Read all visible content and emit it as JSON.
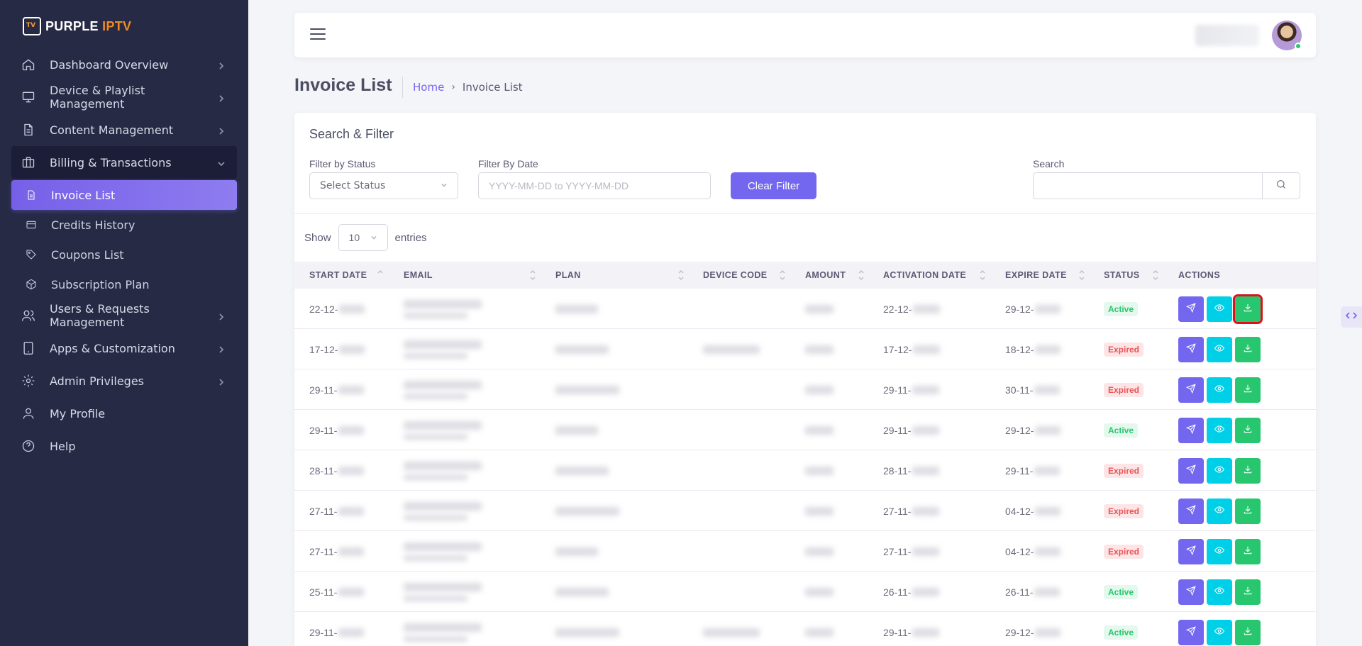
{
  "brand": {
    "part1": "PURPLE",
    "part2": "IPTV"
  },
  "sidebar": {
    "items": [
      {
        "label": "Dashboard Overview",
        "icon": "home-icon"
      },
      {
        "label": "Device & Playlist Management",
        "icon": "monitor-icon"
      },
      {
        "label": "Content Management",
        "icon": "file-icon"
      },
      {
        "label": "Billing & Transactions",
        "icon": "briefcase-icon"
      },
      {
        "label": "Users & Requests Management",
        "icon": "users-icon"
      },
      {
        "label": "Apps & Customization",
        "icon": "tablet-icon"
      },
      {
        "label": "Admin Privileges",
        "icon": "gear-icon"
      },
      {
        "label": "My Profile",
        "icon": "user-icon"
      },
      {
        "label": "Help",
        "icon": "help-icon"
      }
    ],
    "billing_sub": [
      {
        "label": "Invoice List",
        "icon": "document-icon"
      },
      {
        "label": "Credits History",
        "icon": "credit-card-icon"
      },
      {
        "label": "Coupons List",
        "icon": "tag-icon"
      },
      {
        "label": "Subscription Plan",
        "icon": "box-icon"
      }
    ]
  },
  "header": {
    "title": "Invoice List",
    "breadcrumb_home": "Home",
    "breadcrumb_sep": "›",
    "breadcrumb_current": "Invoice List"
  },
  "filters": {
    "title": "Search & Filter",
    "status_label": "Filter by Status",
    "status_value": "Select Status",
    "date_label": "Filter By Date",
    "date_placeholder": "YYYY-MM-DD to YYYY-MM-DD",
    "clear_label": "Clear Filter",
    "search_label": "Search"
  },
  "length": {
    "show": "Show",
    "value": "10",
    "entries": "entries"
  },
  "table": {
    "columns": [
      "START DATE",
      "EMAIL",
      "PLAN",
      "DEVICE CODE",
      "AMOUNT",
      "ACTIVATION DATE",
      "EXPIRE DATE",
      "STATUS",
      "ACTIONS"
    ],
    "rows": [
      {
        "start": "22-12-",
        "activation": "22-12-",
        "expire": "29-12-",
        "status": "Active",
        "device": false
      },
      {
        "start": "17-12-",
        "activation": "17-12-",
        "expire": "18-12-",
        "status": "Expired",
        "device": true
      },
      {
        "start": "29-11-",
        "activation": "29-11-",
        "expire": "30-11-",
        "status": "Expired",
        "device": false
      },
      {
        "start": "29-11-",
        "activation": "29-11-",
        "expire": "29-12-",
        "status": "Active",
        "device": false
      },
      {
        "start": "28-11-",
        "activation": "28-11-",
        "expire": "29-11-",
        "status": "Expired",
        "device": false
      },
      {
        "start": "27-11-",
        "activation": "27-11-",
        "expire": "04-12-",
        "status": "Expired",
        "device": false
      },
      {
        "start": "27-11-",
        "activation": "27-11-",
        "expire": "04-12-",
        "status": "Expired",
        "device": false
      },
      {
        "start": "25-11-",
        "activation": "26-11-",
        "expire": "26-11-",
        "status": "Active",
        "device": false
      },
      {
        "start": "29-11-",
        "activation": "29-11-",
        "expire": "29-12-",
        "status": "Active",
        "device": true
      }
    ]
  },
  "colors": {
    "accent": "#7367f0",
    "info": "#00cfe8",
    "success": "#28c76f",
    "danger": "#ea5455",
    "sidebar": "#262a45",
    "highlight": "#e0111b"
  }
}
